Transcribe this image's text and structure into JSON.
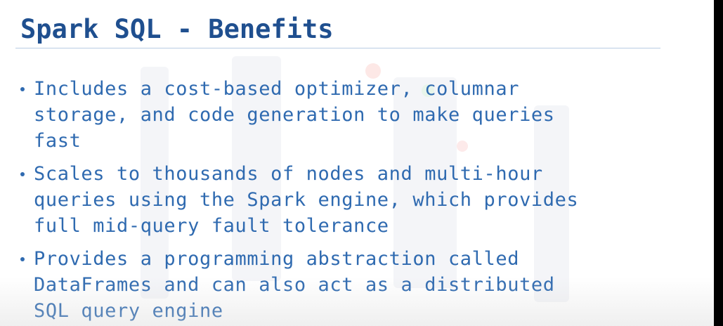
{
  "slide": {
    "title": "Spark SQL - Benefits",
    "bullets": [
      {
        "lines": [
          "Includes a cost-based optimizer, columnar",
          "storage, and code generation to make queries",
          "fast"
        ]
      },
      {
        "lines": [
          "Scales to thousands of nodes and multi-hour",
          "queries using the Spark engine, which provides",
          "full mid-query fault tolerance"
        ]
      },
      {
        "lines": [
          "Provides a programming abstraction called",
          "DataFrames and can also act as a distributed",
          "SQL query engine"
        ]
      }
    ]
  },
  "colors": {
    "title": "#1f4f8f",
    "body_text": "#2f6ab0",
    "rule": "#b9cde3",
    "background": "#ffffff",
    "right_edge": "#000000"
  }
}
